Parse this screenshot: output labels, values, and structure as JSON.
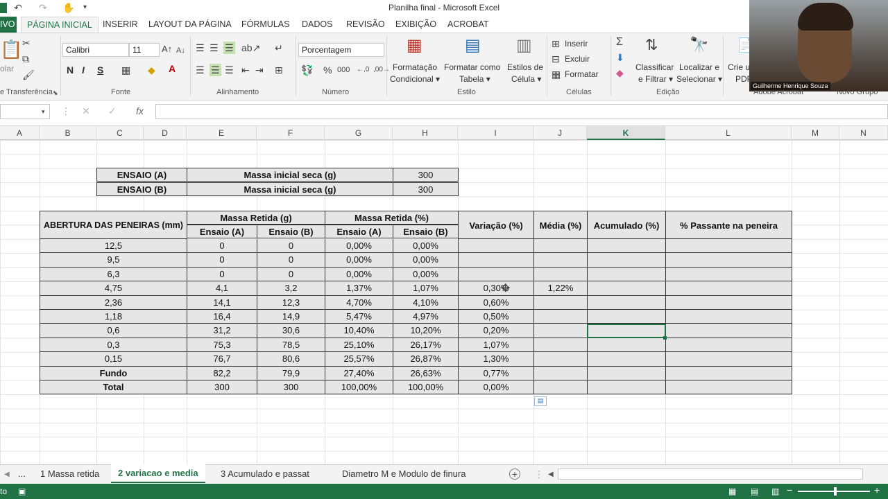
{
  "window": {
    "title": "Planilha final - Microsoft Excel"
  },
  "tabs": {
    "file": "IVO",
    "items": [
      "PÁGINA INICIAL",
      "INSERIR",
      "LAYOUT DA PÁGINA",
      "FÓRMULAS",
      "DADOS",
      "REVISÃO",
      "EXIBIÇÃO",
      "ACROBAT"
    ]
  },
  "ribbon": {
    "paste_label": "olar",
    "font_name": "Calibri",
    "font_size": "11",
    "number_format": "Porcentagem",
    "bold": "N",
    "italic": "I",
    "underline": "S",
    "cond_format": [
      "Formatação",
      "Condicional ▾"
    ],
    "format_table": [
      "Formatar como",
      "Tabela ▾"
    ],
    "cell_styles": [
      "Estilos de",
      "Célula ▾"
    ],
    "insert": "Inserir",
    "delete": "Excluir",
    "format": "Formatar",
    "sort_filter": [
      "Classificar",
      "e Filtrar ▾"
    ],
    "find_select": [
      "Localizar e",
      "Selecionar ▾"
    ],
    "create_pdf": [
      "Crie u",
      "PDF"
    ],
    "groups": {
      "clipboard": "e Transferência",
      "font": "Fonte",
      "alignment": "Alinhamento",
      "number": "Número",
      "style": "Estilo",
      "cells": "Células",
      "editing": "Edição",
      "acrobat": "Adobe Acrobat",
      "new_group": "Novo Grupo"
    }
  },
  "webcam": {
    "name": "Guilherme Henrique Souza"
  },
  "columns": [
    "A",
    "B",
    "C",
    "D",
    "E",
    "F",
    "G",
    "H",
    "I",
    "J",
    "K",
    "L",
    "M",
    "N"
  ],
  "selected_column": "K",
  "top_table": [
    {
      "label": "ENSAIO (A)",
      "desc": "Massa inicial seca (g)",
      "value": "300"
    },
    {
      "label": "ENSAIO (B)",
      "desc": "Massa inicial seca (g)",
      "value": "300"
    }
  ],
  "headers": {
    "abertura": "ABERTURA DAS PENEIRAS (mm)",
    "massa_g": "Massa Retida (g)",
    "massa_pct": "Massa Retida (%)",
    "ensaio_a": "Ensaio (A)",
    "ensaio_b": "Ensaio (B)",
    "variacao": "Variação (%)",
    "media": "Média (%)",
    "acumulado": "Acumulado (%)",
    "passante": "% Passante na peneira"
  },
  "rows": [
    [
      "12,5",
      "0",
      "0",
      "0,00%",
      "0,00%",
      "",
      "",
      "",
      ""
    ],
    [
      "9,5",
      "0",
      "0",
      "0,00%",
      "0,00%",
      "",
      "",
      "",
      ""
    ],
    [
      "6,3",
      "0",
      "0",
      "0,00%",
      "0,00%",
      "",
      "",
      "",
      ""
    ],
    [
      "4,75",
      "4,1",
      "3,2",
      "1,37%",
      "1,07%",
      "0,30%",
      "1,22%",
      "",
      ""
    ],
    [
      "2,36",
      "14,1",
      "12,3",
      "4,70%",
      "4,10%",
      "0,60%",
      "",
      "",
      ""
    ],
    [
      "1,18",
      "16,4",
      "14,9",
      "5,47%",
      "4,97%",
      "0,50%",
      "",
      "",
      ""
    ],
    [
      "0,6",
      "31,2",
      "30,6",
      "10,40%",
      "10,20%",
      "0,20%",
      "",
      "",
      ""
    ],
    [
      "0,3",
      "75,3",
      "78,5",
      "25,10%",
      "26,17%",
      "1,07%",
      "",
      "",
      ""
    ],
    [
      "0,15",
      "76,7",
      "80,6",
      "25,57%",
      "26,87%",
      "1,30%",
      "",
      "",
      ""
    ],
    [
      "Fundo",
      "82,2",
      "79,9",
      "27,40%",
      "26,63%",
      "0,77%",
      "",
      "",
      ""
    ],
    [
      "Total",
      "300",
      "300",
      "100,00%",
      "100,00%",
      "0,00%",
      "",
      "",
      ""
    ]
  ],
  "sheets": {
    "more": "...",
    "items": [
      "1 Massa retida",
      "2 variacao e media",
      "3 Acumulado e passat",
      "Diametro M e Modulo de finura"
    ],
    "active": "2 variacao e media"
  },
  "status": {
    "left": "to"
  }
}
